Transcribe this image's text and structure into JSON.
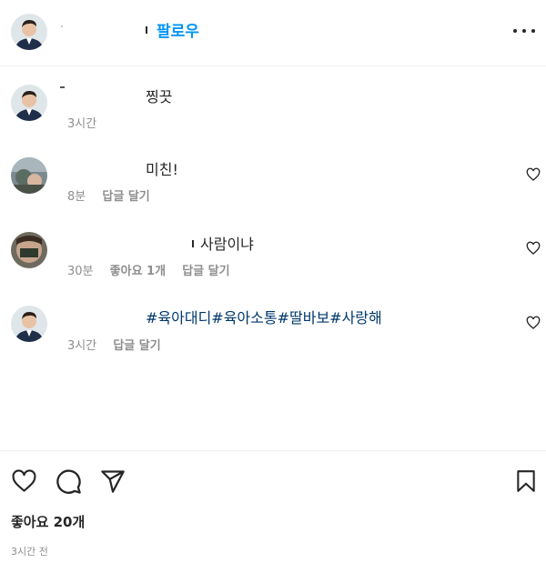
{
  "header": {
    "follow_label": "팔로우",
    "more_icon": "more-horizontal-icon"
  },
  "comments": [
    {
      "text": "찡끗",
      "time": "3시간",
      "likes": "",
      "reply": "",
      "show_heart": false
    },
    {
      "text": "미친!",
      "time": "8분",
      "likes": "",
      "reply": "답글 달기",
      "show_heart": true
    },
    {
      "text": "사람이냐",
      "time": "30분",
      "likes": "좋아요 1개",
      "reply": "답글 달기",
      "show_heart": true
    },
    {
      "text": "",
      "tags": [
        "#육아대디",
        "#육아소통",
        "#딸바보",
        "#사랑해"
      ],
      "time": "3시간",
      "likes": "",
      "reply": "답글 달기",
      "show_heart": true
    }
  ],
  "footer": {
    "likes_label": "좋아요 20개",
    "timestamp": "3시간 전"
  },
  "colors": {
    "follow": "#0095f6",
    "hashtag": "#00376b",
    "secondary_text": "#8e8e8e"
  }
}
